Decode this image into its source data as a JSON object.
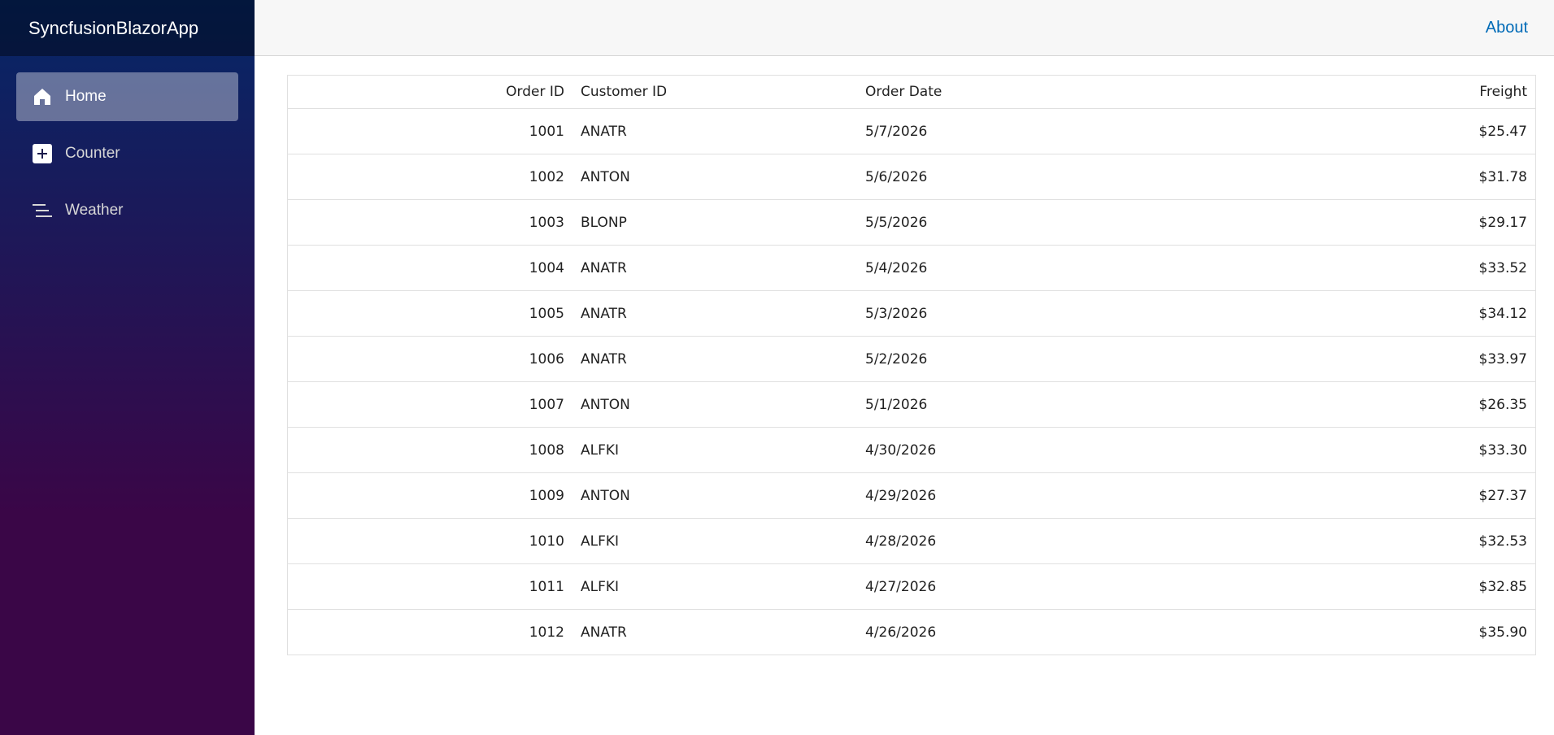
{
  "sidebar": {
    "brand": "SyncfusionBlazorApp",
    "items": [
      {
        "label": "Home",
        "icon": "home-icon",
        "active": true
      },
      {
        "label": "Counter",
        "icon": "plus-square-icon",
        "active": false
      },
      {
        "label": "Weather",
        "icon": "list-lines-icon",
        "active": false
      }
    ]
  },
  "header": {
    "about_label": "About"
  },
  "grid": {
    "columns": [
      "Order ID",
      "Customer ID",
      "Order Date",
      "Freight"
    ],
    "rows": [
      [
        "1001",
        "ANATR",
        "5/7/2026",
        "$25.47"
      ],
      [
        "1002",
        "ANTON",
        "5/6/2026",
        "$31.78"
      ],
      [
        "1003",
        "BLONP",
        "5/5/2026",
        "$29.17"
      ],
      [
        "1004",
        "ANATR",
        "5/4/2026",
        "$33.52"
      ],
      [
        "1005",
        "ANATR",
        "5/3/2026",
        "$34.12"
      ],
      [
        "1006",
        "ANATR",
        "5/2/2026",
        "$33.97"
      ],
      [
        "1007",
        "ANTON",
        "5/1/2026",
        "$26.35"
      ],
      [
        "1008",
        "ALFKI",
        "4/30/2026",
        "$33.30"
      ],
      [
        "1009",
        "ANTON",
        "4/29/2026",
        "$27.37"
      ],
      [
        "1010",
        "ALFKI",
        "4/28/2026",
        "$32.53"
      ],
      [
        "1011",
        "ALFKI",
        "4/27/2026",
        "$32.85"
      ],
      [
        "1012",
        "ANATR",
        "4/26/2026",
        "$35.90"
      ]
    ]
  },
  "colors": {
    "sidebar_top": "#052767",
    "sidebar_bottom": "#3a0647",
    "link": "#006bb7",
    "header_bg": "#f7f7f7"
  }
}
